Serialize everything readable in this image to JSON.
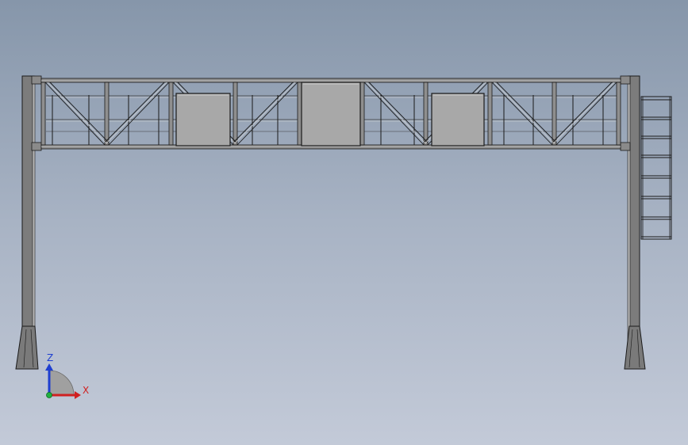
{
  "window": {
    "title": ""
  },
  "triad": {
    "z_label": "Z",
    "x_label": "X",
    "z_color": "#1f3fd0",
    "x_color": "#d02020",
    "y_color": "#20b040"
  },
  "model": {
    "type": "overhead-sign-gantry",
    "panels": [
      "left-sign-panel",
      "center-sign-panel",
      "right-sign-panel"
    ],
    "colors": {
      "steel": "#707070",
      "steel_light": "#a9a9a9",
      "panel_fill": "#a8a8a8",
      "edge": "#1a1a1a"
    }
  }
}
